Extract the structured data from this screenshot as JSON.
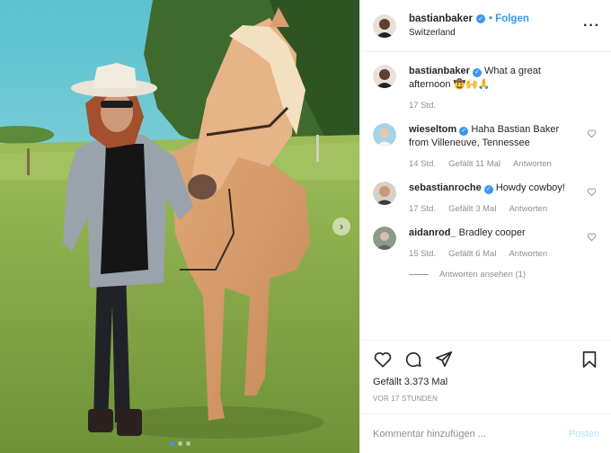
{
  "post": {
    "author": "bastianbaker",
    "follow_label": "• Folgen",
    "location": "Switzerland",
    "more_label": "···"
  },
  "comments": [
    {
      "username": "bastianbaker",
      "verified": true,
      "text": "What a great afternoon 🤠🙌🙏",
      "time": "17 Std."
    },
    {
      "username": "wieseltom",
      "verified": true,
      "text": "Haha Bastian Baker from Villeneuve, Tennessee",
      "time": "14 Std.",
      "likes": "Gefällt 11 Mal",
      "reply_label": "Antworten"
    },
    {
      "username": "sebastianroche",
      "verified": true,
      "text": "Howdy cowboy!",
      "time": "17 Std.",
      "likes": "Gefällt 3 Mal",
      "reply_label": "Antworten"
    },
    {
      "username": "aidanrod_",
      "verified": false,
      "text": "Bradley cooper",
      "time": "15 Std.",
      "likes": "Gefällt 6 Mal",
      "reply_label": "Antworten",
      "view_replies": "Antworten ansehen (1)"
    }
  ],
  "actions": {
    "likes": "Gefällt 3.373 Mal",
    "time": "VOR 17 STUNDEN"
  },
  "comment_box": {
    "placeholder": "Kommentar hinzufügen ...",
    "post_label": "Posten"
  },
  "carousel": {
    "current": 1,
    "total": 3
  },
  "colors": {
    "accent": "#3897f0",
    "muted": "#8e8e8e",
    "post_button_disabled": "#b2dffc"
  },
  "icons": [
    "heart-icon",
    "comment-icon",
    "share-icon",
    "bookmark-icon",
    "more-icon",
    "verified-badge-icon",
    "chevron-right-icon"
  ]
}
